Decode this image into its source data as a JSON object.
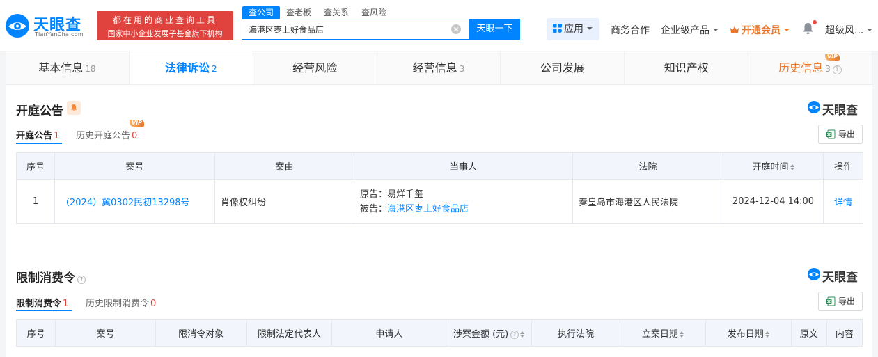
{
  "header": {
    "logo_text": "天眼查",
    "logo_sub": "TianYanCha.com",
    "slogan_line1": "都在用的商业查询工具",
    "slogan_line2": "国家中小企业发展子基金旗下机构",
    "search_tabs": [
      "查公司",
      "查老板",
      "查关系",
      "查风险"
    ],
    "search_value": "海港区枣上好食品店",
    "search_button": "天眼一下",
    "apps_label": "应用",
    "nav": {
      "business": "商务合作",
      "enterprise": "企业级产品",
      "vip": "开通会员",
      "user": "超级风..."
    }
  },
  "tabs": [
    {
      "label": "基本信息",
      "count": "18"
    },
    {
      "label": "法律诉讼",
      "count": "2"
    },
    {
      "label": "经营风险",
      "count": ""
    },
    {
      "label": "经营信息",
      "count": "3"
    },
    {
      "label": "公司发展",
      "count": ""
    },
    {
      "label": "知识产权",
      "count": ""
    },
    {
      "label": "历史信息",
      "count": "3"
    }
  ],
  "vip_tag": "VIP",
  "watermark": "天眼查",
  "hearing": {
    "title": "开庭公告",
    "subtabs": [
      {
        "label": "开庭公告",
        "count": "1"
      },
      {
        "label": "历史开庭公告",
        "count": "0"
      }
    ],
    "export_label": "导出",
    "columns": [
      "序号",
      "案号",
      "案由",
      "当事人",
      "法院",
      "开庭时间",
      "操作"
    ],
    "rows": [
      {
        "index": "1",
        "case_no": "（2024）冀0302民初13298号",
        "cause": "肖像权纠纷",
        "plaintiff_label": "原告：",
        "plaintiff": "易烊千玺",
        "defendant_label": "被告：",
        "defendant": "海港区枣上好食品店",
        "court": "秦皇岛市海港区人民法院",
        "time": "2024-12-04 14:00",
        "action": "详情"
      }
    ]
  },
  "restriction": {
    "title": "限制消费令",
    "subtabs": [
      {
        "label": "限制消费令",
        "count": "1"
      },
      {
        "label": "历史限制消费令",
        "count": "0"
      }
    ],
    "export_label": "导出",
    "columns": [
      "序号",
      "案号",
      "限消令对象",
      "限制法定代表人",
      "申请人",
      "涉案金额 (元)",
      "执行法院",
      "立案日期",
      "发布日期",
      "原文",
      "内容"
    ]
  },
  "colors": {
    "brand_blue": "#0084ff",
    "slogan_red": "#e0433d",
    "vip_orange": "#e8762b",
    "header_bg_table": "#f2f6fc"
  }
}
